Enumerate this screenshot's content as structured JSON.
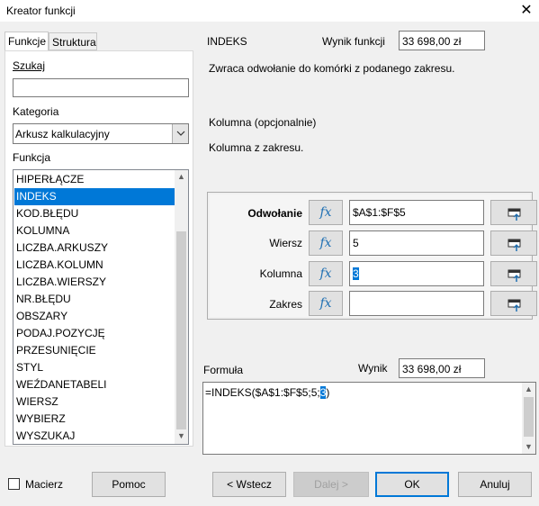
{
  "window": {
    "title": "Kreator funkcji",
    "close_glyph": "✕"
  },
  "tabs": [
    {
      "label": "Funkcje"
    },
    {
      "label": "Struktura"
    }
  ],
  "left": {
    "search_label": "Szukaj",
    "search_value": "",
    "category_label": "Kategoria",
    "category_value": "Arkusz kalkulacyjny",
    "function_label": "Funkcja",
    "functions": [
      "HIPERŁĄCZE",
      "INDEKS",
      "KOD.BŁĘDU",
      "KOLUMNA",
      "LICZBA.ARKUSZY",
      "LICZBA.KOLUMN",
      "LICZBA.WIERSZY",
      "NR.BŁĘDU",
      "OBSZARY",
      "PODAJ.POZYCJĘ",
      "PRZESUNIĘCIE",
      "STYL",
      "WEŹDANETABELI",
      "WIERSZ",
      "WYBIERZ",
      "WYSZUKAJ"
    ],
    "selected_function": "INDEKS"
  },
  "right": {
    "function_name": "INDEKS",
    "result_label": "Wynik funkcji",
    "result_value": "33 698,00 zł",
    "description": "Zwraca odwołanie do komórki z podanego zakresu.",
    "arg_title": "Kolumna (opcjonalnie)",
    "arg_description": "Kolumna z zakresu.",
    "fx_glyph": "fx",
    "args": [
      {
        "label": "Odwołanie",
        "value": "$A$1:$F$5",
        "bold": true
      },
      {
        "label": "Wiersz",
        "value": "5"
      },
      {
        "label": "Kolumna",
        "value": "3"
      },
      {
        "label": "Zakres",
        "value": ""
      }
    ],
    "formula_label": "Formuła",
    "formula_result_label": "Wynik",
    "formula_result_value": "33 698,00 zł",
    "formula_prefix": "=INDEKS($A$1:$F$5;5;",
    "formula_selected": "3",
    "formula_suffix": ")"
  },
  "footer": {
    "array_label": "Macierz",
    "help_label": "Pomoc",
    "back_label": "< Wstecz",
    "next_label": "Dalej >",
    "ok_label": "OK",
    "cancel_label": "Anuluj"
  }
}
